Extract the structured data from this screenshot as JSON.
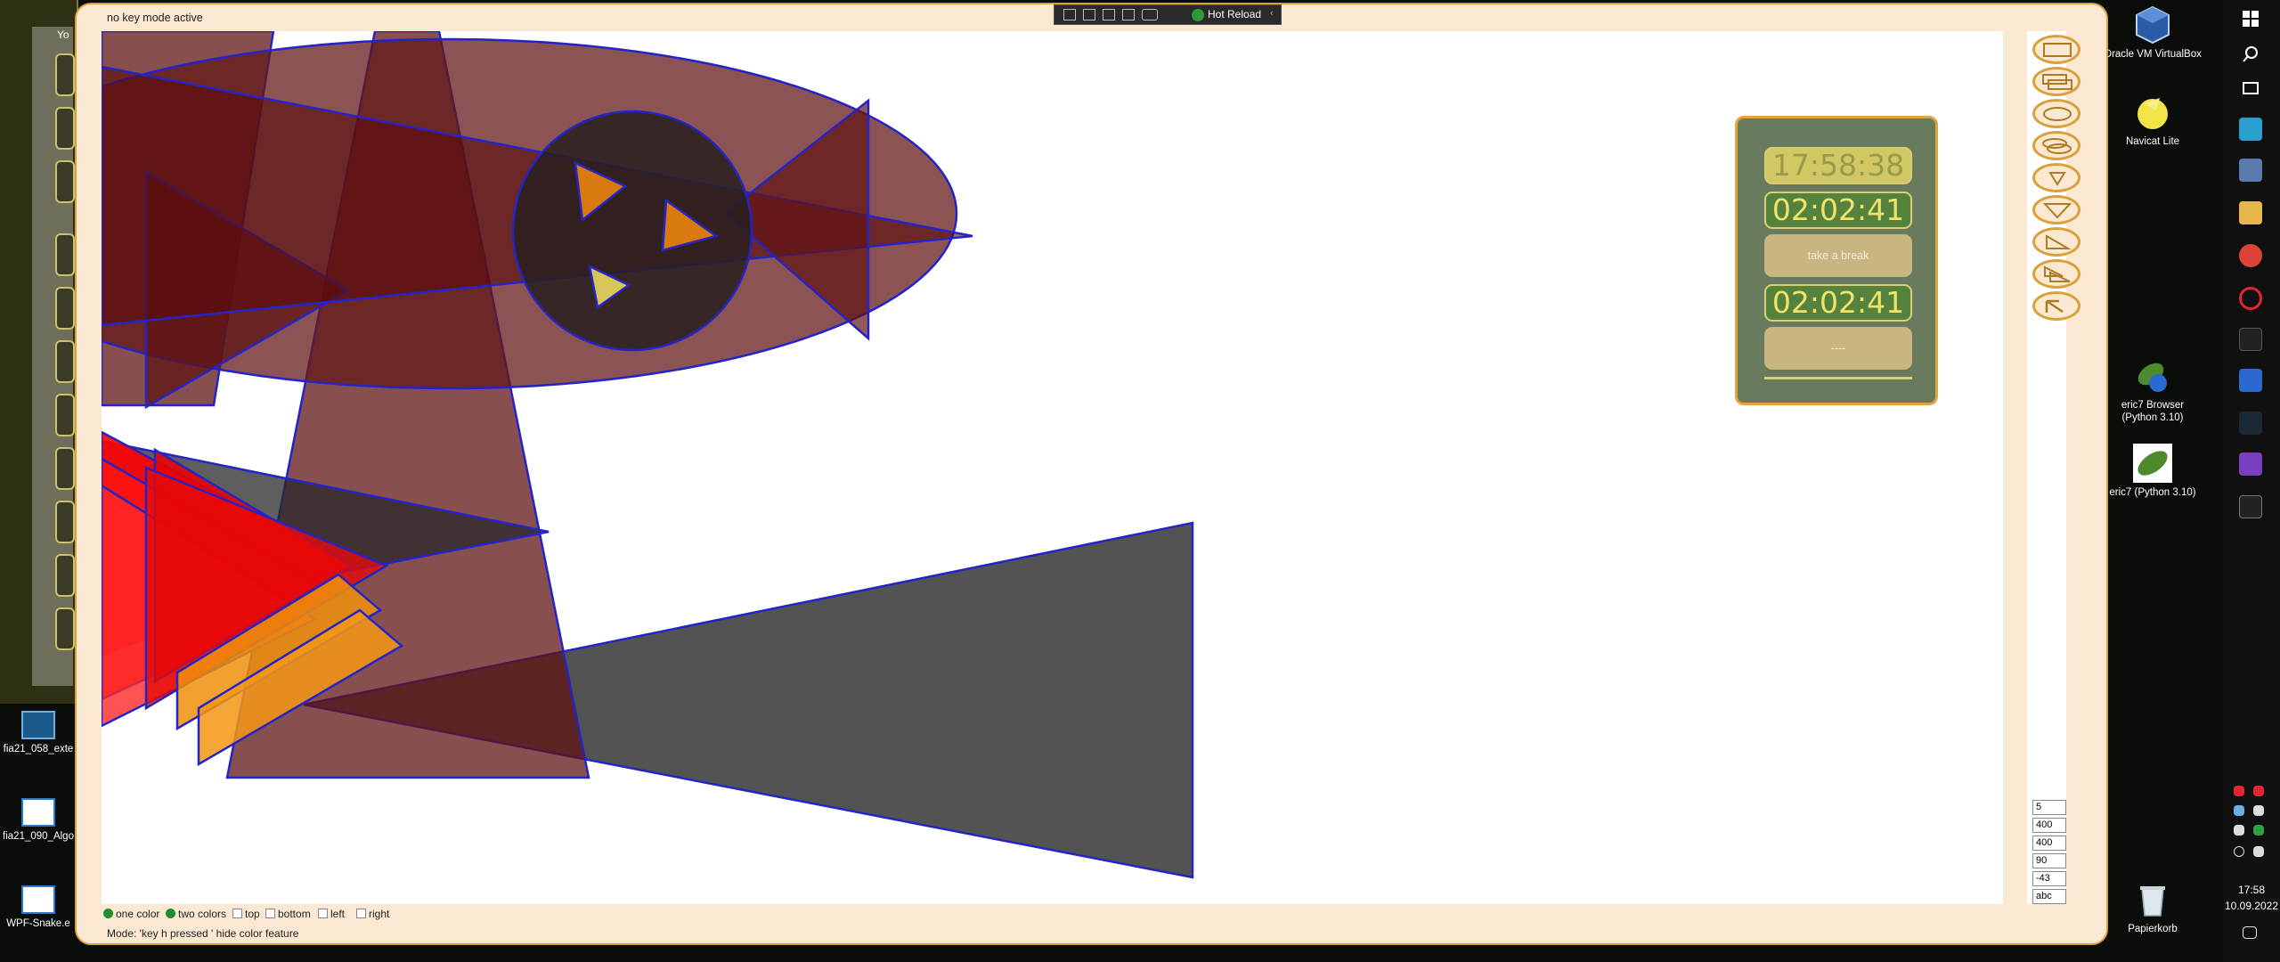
{
  "app": {
    "status_text": "no key mode active",
    "help_text": "Mode: 'key h pressed ' hide color feature"
  },
  "debug_toolbar": {
    "hot_reload_label": "Hot Reload"
  },
  "clock_panel": {
    "current_time": "17:58:38",
    "timer_1": "02:02:41",
    "break_label": "take a break",
    "timer_2": "02:02:41",
    "dash_label": "----"
  },
  "tools": [
    "rectangle-tool",
    "stacked-rectangles-tool",
    "ellipse-tool",
    "stacked-ellipses-tool",
    "small-triangle-tool",
    "triangle-tool",
    "right-triangle-tool",
    "stacked-triangles-tool",
    "arrow-tool"
  ],
  "fields": {
    "f1": "5",
    "f2": "400",
    "f3": "400",
    "f4": "90",
    "f5": "-43",
    "f6": "abc"
  },
  "bottom_options": {
    "one_color": "one color",
    "two_colors": "two colors",
    "top": "top",
    "bottom": "bottom",
    "left": "left",
    "right": "right"
  },
  "desktop": {
    "left_title": "Yo",
    "icon_1": "fia21_058_exte",
    "icon_2": "fia21_090_Algo",
    "icon_3": "WPF-Snake.e",
    "icon_vbox": "Oracle VM VirtualBox",
    "icon_navicat": "Navicat Lite",
    "icon_eric_browser_1": "eric7 Browser",
    "icon_eric_browser_2": "(Python 3.10)",
    "icon_eric": "eric7 (Python 3.10)",
    "icon_trash": "Papierkorb"
  },
  "taskbar": {
    "time": "17:58",
    "date": "10.09.2022"
  },
  "colors": {
    "window_bg": "#fbe8d2",
    "window_border": "#d8a13a",
    "shape_maroon": "#6b1414",
    "shape_gray": "#3a3a3a",
    "shape_red": "#ff0000",
    "shape_orange": "#f0900a",
    "shape_outline": "#2424c8",
    "panel_green": "#687b5e"
  }
}
